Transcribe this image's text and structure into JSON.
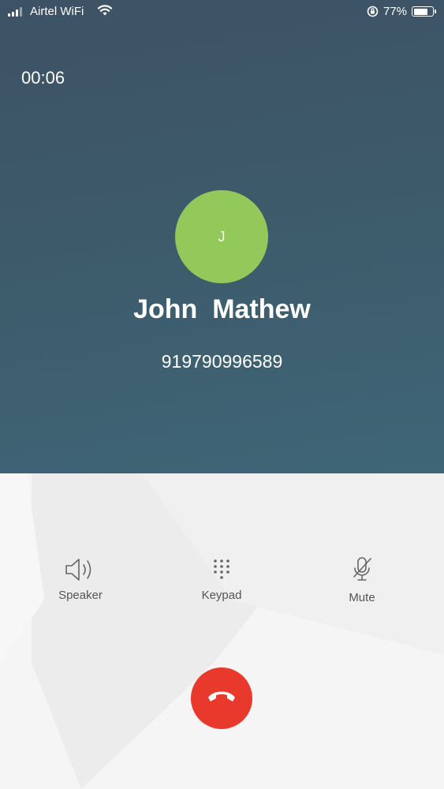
{
  "status_bar": {
    "carrier": "Airtel WiFi",
    "battery_percent": "77%",
    "battery_level": 0.77,
    "icons": [
      "signal-icon",
      "wifi-icon",
      "orientation-lock-icon",
      "battery-icon"
    ]
  },
  "call": {
    "timer": "00:06",
    "avatar_initial": "J",
    "avatar_color": "#93c85a",
    "caller_name": "John  Mathew",
    "caller_number": "919790996589"
  },
  "controls": {
    "speaker": {
      "label": "Speaker",
      "icon": "speaker-icon"
    },
    "keypad": {
      "label": "Keypad",
      "icon": "keypad-icon"
    },
    "mute": {
      "label": "Mute",
      "icon": "microphone-muted-icon"
    }
  },
  "end_call": {
    "icon": "hang-up-icon",
    "color": "#e8392c"
  },
  "colors": {
    "header_background": "#3d5a6a",
    "bottom_background": "#f5f5f5"
  }
}
